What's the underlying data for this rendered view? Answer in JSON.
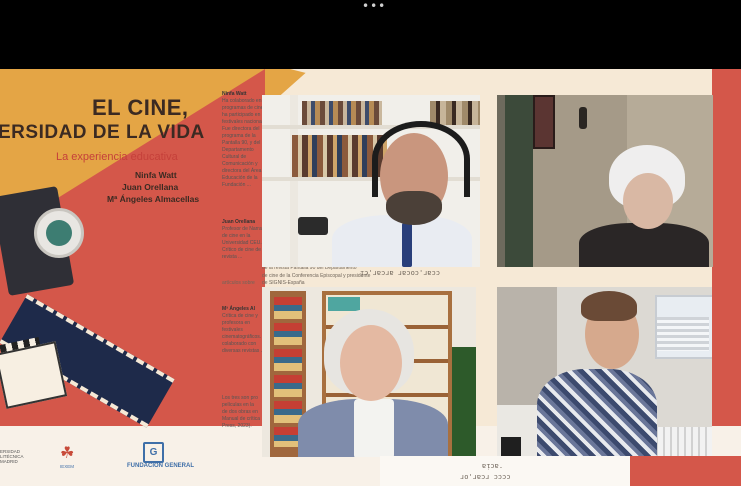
{
  "window": {
    "menu_dots": "•••"
  },
  "slide": {
    "title_line1": "EL CINE,",
    "title_line2": "ERSIDAD DE LA VIDA",
    "subtitle": "La experiencia educativa",
    "authors": [
      "Ninfa Watt",
      "Juan Orellana",
      "Mª Ángeles Almacellas"
    ],
    "logos": {
      "left_line1": "ERSIDAD",
      "left_line2": "LITÉCNICA",
      "left_line3": "MADRID",
      "center_label": "IEXEM",
      "right_mark": "G",
      "right_name": "FUNDACIÓN GENERAL"
    },
    "doc": {
      "heading1": "Ninfa Watt",
      "para1": "Ha colaborado en programas de cine y ha participado en festivales nacionales. Fue directora del programa de la Pantalla 90, y del Departamento Cultural de Comunicación y directora del Área de Educación de la Fundación ...",
      "heading2": "Juan Orellana",
      "para2": "Profesor de Narrativa de cine en la Universidad CEU. Crítico de cine de la revista ...",
      "heading3": "Mª Ángeles Al",
      "para3": "Crítica de cine y profesora en festivales cinematográficos. Ha colaborado con diversas revistas ...",
      "line_review": "de la revista Pantalla 90 del Departamento",
      "line_conf": "de cine de la Conferencia Episcopal y presidente",
      "line_signis": "de SIGNIS-España",
      "line_articles": "artículos sobre",
      "tail1": "Los tres son pro",
      "tail2": "películas en la",
      "tail3": "de dos obras en",
      "tail4": "Manual de crítica",
      "tail5": "Press, 2023)."
    },
    "mirrored_caption_1": "ᴉɔ'ɹɐɔɹɐ ɹɐɔoɔ'ɹɐɔɔ",
    "mirrored_caption_2": "ɐᴉɔɐ.",
    "mirrored_caption_3": "ɹo'ɹɐɔɹ ɔɔɔɔ"
  },
  "participants": [
    {
      "id": "p1",
      "description_label": "Bearded man with headset"
    },
    {
      "id": "p2",
      "description_label": "Woman with white hair"
    },
    {
      "id": "p3",
      "description_label": "Smiling woman with grey hair"
    },
    {
      "id": "p4",
      "description_label": "Man with glasses at desk"
    }
  ],
  "colors": {
    "orange": "#e4a545",
    "red": "#d4574a",
    "cream": "#f6e9d6",
    "navy": "#1e2a4a",
    "teal": "#3d7d72"
  }
}
